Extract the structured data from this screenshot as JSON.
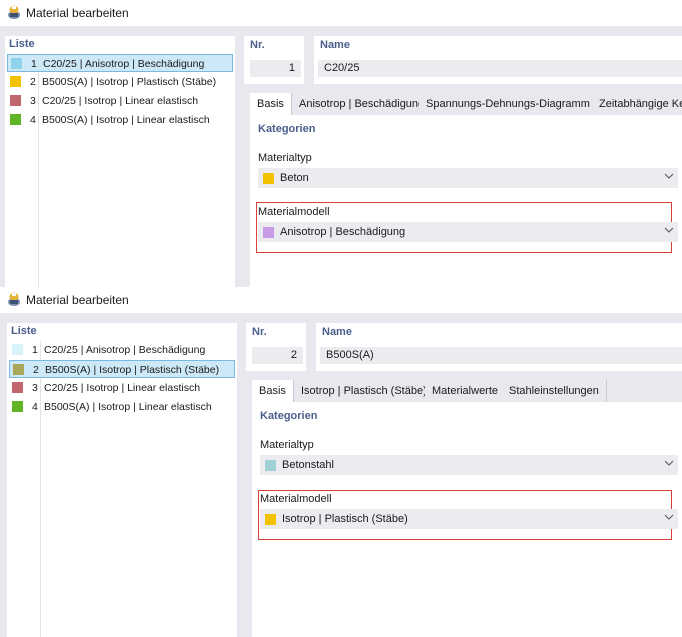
{
  "panels": [
    {
      "title": "Material bearbeiten",
      "list": {
        "header": "Liste",
        "items": [
          {
            "num": "1",
            "text": "C20/25 | Anisotrop | Beschädigung",
            "color": "#8fd3ea"
          },
          {
            "num": "2",
            "text": "B500S(A) | Isotrop | Plastisch (Stäbe)",
            "color": "#f2c200"
          },
          {
            "num": "3",
            "text": "C20/25 | Isotrop | Linear elastisch",
            "color": "#c0666c"
          },
          {
            "num": "4",
            "text": "B500S(A) | Isotrop | Linear elastisch",
            "color": "#5fb526"
          }
        ],
        "selected_index": 0
      },
      "nr_label": "Nr.",
      "nr_value": "1",
      "name_label": "Name",
      "name_value": "C20/25",
      "tabs": [
        "Basis",
        "Anisotrop | Beschädigung",
        "Spannungs-Dehnungs-Diagramm",
        "Zeitabhängige Ke"
      ],
      "active_tab": 0,
      "section_title": "Kategorien",
      "materialtyp_label": "Materialtyp",
      "materialtyp_value": "Beton",
      "materialtyp_color": "#f2c200",
      "materialmodell_label": "Materialmodell",
      "materialmodell_value": "Anisotrop | Beschädigung",
      "materialmodell_color": "#c79be8"
    },
    {
      "title": "Material bearbeiten",
      "list": {
        "header": "Liste",
        "items": [
          {
            "num": "1",
            "text": "C20/25 | Anisotrop | Beschädigung",
            "color": "#d8f4fb"
          },
          {
            "num": "2",
            "text": "B500S(A) | Isotrop | Plastisch (Stäbe)",
            "color": "#a9a85a"
          },
          {
            "num": "3",
            "text": "C20/25 | Isotrop | Linear elastisch",
            "color": "#c0666c"
          },
          {
            "num": "4",
            "text": "B500S(A) | Isotrop | Linear elastisch",
            "color": "#5fb526"
          }
        ],
        "selected_index": 1
      },
      "nr_label": "Nr.",
      "nr_value": "2",
      "name_label": "Name",
      "name_value": "B500S(A)",
      "tabs": [
        "Basis",
        "Isotrop | Plastisch (Stäbe)",
        "Materialwerte",
        "Stahleinstellungen"
      ],
      "active_tab": 0,
      "section_title": "Kategorien",
      "materialtyp_label": "Materialtyp",
      "materialtyp_value": "Betonstahl",
      "materialtyp_color": "#9fd1d4",
      "materialmodell_label": "Materialmodell",
      "materialmodell_value": "Isotrop | Plastisch (Stäbe)",
      "materialmodell_color": "#f2c200"
    }
  ]
}
